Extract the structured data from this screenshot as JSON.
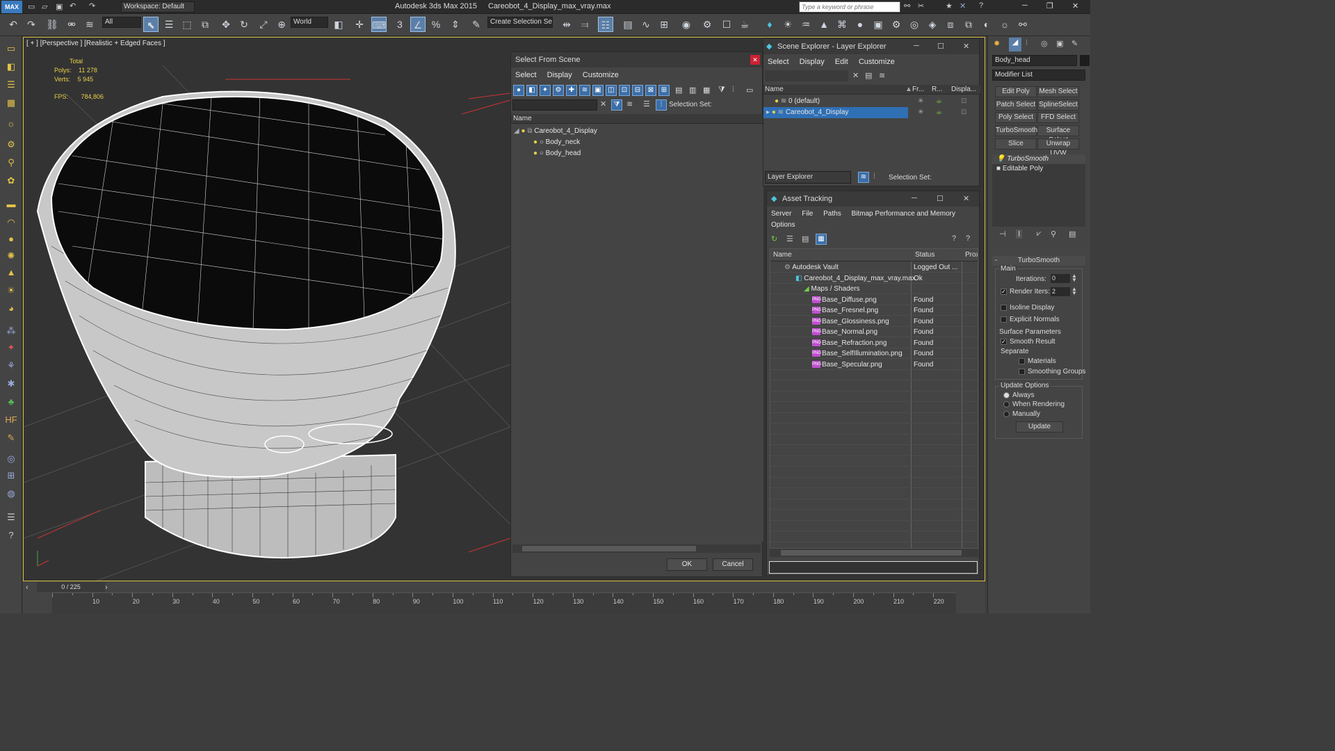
{
  "app": {
    "title": "Autodesk 3ds Max  2015",
    "file": "Careobot_4_Display_max_vray.max",
    "logo": "MAX",
    "workspace": "Workspace: Default",
    "search_placeholder": "Type a keyword or phrase"
  },
  "toolbar": {
    "filter": "All",
    "coord": "World",
    "selection_set": "Create Selection Se",
    "icons": [
      "undo-icon",
      "redo-icon",
      "link-icon",
      "unlink-icon",
      "bind-icon",
      "select-icon",
      "select-by-name-icon",
      "rect-region-icon",
      "window-crossing-icon",
      "move-icon",
      "rotate-icon",
      "scale-icon",
      "pivot-icon",
      "mirror-icon",
      "align-icon",
      "snap-icon",
      "angle-snap-icon",
      "percent-snap-icon",
      "spinner-snap-icon"
    ]
  },
  "viewport": {
    "label": "[ + ] [Perspective ] [Realistic + Edged Faces ]",
    "stats": {
      "total": "Total",
      "polys_label": "Polys:",
      "polys": "11 278",
      "verts_label": "Verts:",
      "verts": "5 945",
      "fps_label": "FPS:",
      "fps": "784,806"
    }
  },
  "timeline": {
    "frame": "0 / 225",
    "ticks": [
      "10",
      "20",
      "30",
      "40",
      "50",
      "60",
      "70",
      "80",
      "90",
      "100",
      "110",
      "120",
      "130",
      "140",
      "150",
      "160",
      "170",
      "180",
      "190",
      "200",
      "210",
      "220"
    ]
  },
  "select_from_scene": {
    "title": "Select From Scene",
    "menu": [
      "Select",
      "Display",
      "Customize"
    ],
    "selection_set": "Selection Set:",
    "col_name": "Name",
    "tree": [
      {
        "label": "Careobot_4_Display",
        "level": 0
      },
      {
        "label": "Body_neck",
        "level": 1
      },
      {
        "label": "Body_head",
        "level": 1
      }
    ],
    "ok": "OK",
    "cancel": "Cancel"
  },
  "scene_explorer": {
    "title": "Scene Explorer - Layer Explorer",
    "menu": [
      "Select",
      "Display",
      "Edit",
      "Customize"
    ],
    "cols": [
      "Name",
      "Fr...",
      "R...",
      "Displa..."
    ],
    "rows": [
      "0 (default)",
      "Careobot_4_Display"
    ],
    "footer_label": "Layer Explorer",
    "selection_set": "Selection Set:"
  },
  "asset_tracking": {
    "title": "Asset Tracking",
    "menu": [
      "Server",
      "File",
      "Paths",
      "Bitmap Performance and Memory"
    ],
    "menu2": [
      "Options"
    ],
    "cols": [
      "Name",
      "Status",
      "Prox"
    ],
    "rows": [
      {
        "name": "Autodesk Vault",
        "status": "Logged Out ..."
      },
      {
        "name": "Careobot_4_Display_max_vray.max",
        "status": "Ok"
      },
      {
        "name": "Maps / Shaders",
        "status": ""
      },
      {
        "name": "Base_Diffuse.png",
        "status": "Found"
      },
      {
        "name": "Base_Fresnel.png",
        "status": "Found"
      },
      {
        "name": "Base_Glossiness.png",
        "status": "Found"
      },
      {
        "name": "Base_Normal.png",
        "status": "Found"
      },
      {
        "name": "Base_Refraction.png",
        "status": "Found"
      },
      {
        "name": "Base_SelfIllumination.png",
        "status": "Found"
      },
      {
        "name": "Base_Specular.png",
        "status": "Found"
      }
    ]
  },
  "modify_panel": {
    "object_name": "Body_head",
    "modifier_list": "Modifier List",
    "buttons": [
      "Edit Poly",
      "Mesh Select",
      "Patch Select",
      "SplineSelect",
      "Poly Select",
      "FFD Select",
      "TurboSmooth",
      "Surface Select",
      "Slice",
      "Unwrap UVW"
    ],
    "stack": [
      "TurboSmooth",
      "Editable Poly"
    ],
    "rollout": "TurboSmooth",
    "main": "Main",
    "iterations_label": "Iterations:",
    "iterations": "0",
    "render_iters_label": "Render Iters:",
    "render_iters": "2",
    "isoline": "Isoline Display",
    "explicit": "Explicit Normals",
    "surface_params": "Surface Parameters",
    "smooth_result": "Smooth Result",
    "separate": "Separate",
    "materials": "Materials",
    "smoothing_groups": "Smoothing Groups",
    "update_options": "Update Options",
    "always": "Always",
    "when_rendering": "When Rendering",
    "manually": "Manually",
    "update": "Update"
  }
}
